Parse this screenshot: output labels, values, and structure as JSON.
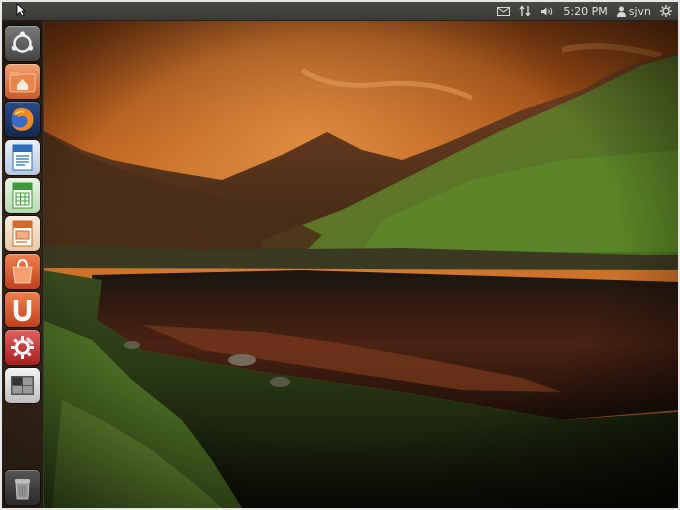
{
  "panel": {
    "clock": "5:20 PM",
    "user": "sjvn",
    "indicators": [
      "mail-icon",
      "network-icon",
      "volume-icon",
      "user-icon",
      "session-gear-icon"
    ]
  },
  "launcher": {
    "items": [
      {
        "name": "dash-home",
        "icon": "ubuntu-logo-icon",
        "color": "#5a5a5a"
      },
      {
        "name": "home-folder",
        "icon": "folder-home-icon",
        "color": "#e0703a"
      },
      {
        "name": "firefox",
        "icon": "firefox-icon",
        "color": "#e07c28"
      },
      {
        "name": "libreoffice-writer",
        "icon": "writer-icon",
        "color": "#2a6fb5"
      },
      {
        "name": "libreoffice-calc",
        "icon": "calc-icon",
        "color": "#3d9a3a"
      },
      {
        "name": "libreoffice-impress",
        "icon": "impress-icon",
        "color": "#d26a2a"
      },
      {
        "name": "software-center",
        "icon": "shopping-bag-icon",
        "color": "#d8542a"
      },
      {
        "name": "ubuntu-one",
        "icon": "ubuntu-one-icon",
        "color": "#d8542a"
      },
      {
        "name": "system-settings",
        "icon": "settings-icon",
        "color": "#c43a3a"
      },
      {
        "name": "workspace-switcher",
        "icon": "workspaces-icon",
        "color": "#d0d0d0"
      },
      {
        "name": "trash",
        "icon": "trash-icon",
        "color": "#8a8a8a"
      }
    ]
  },
  "desktop": {
    "wallpaper": "mountain-lake-sunset",
    "sky_color": "#c0651d",
    "grass_color": "#5a8a2c"
  }
}
